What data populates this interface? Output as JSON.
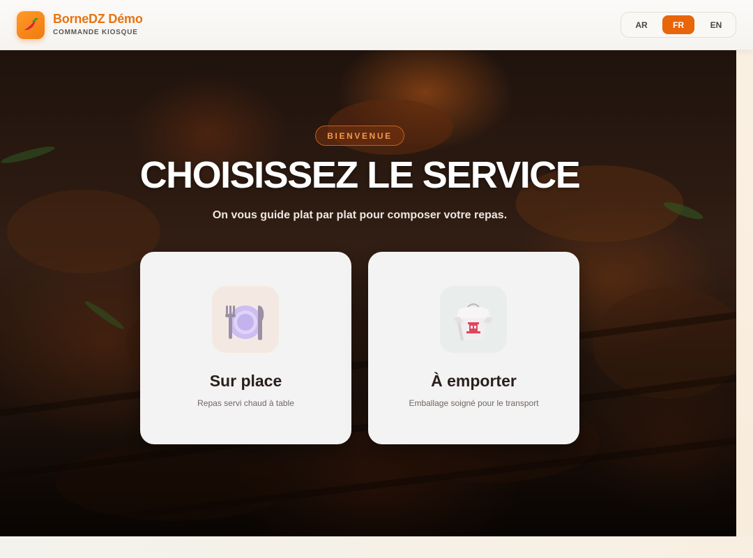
{
  "header": {
    "brand_name": "BorneDZ Démo",
    "brand_sub": "COMMANDE KIOSQUE",
    "logo_icon": "chili-pepper-icon",
    "languages": [
      {
        "label": "AR",
        "active": false
      },
      {
        "label": "FR",
        "active": true
      },
      {
        "label": "EN",
        "active": false
      }
    ]
  },
  "hero": {
    "badge": "BIENVENUE",
    "title": "CHOISISSEZ LE SERVICE",
    "subtitle": "On vous guide plat par plat pour composer votre repas."
  },
  "options": [
    {
      "title": "Sur place",
      "subtitle": "Repas servi chaud à table",
      "icon": "plate-cutlery-icon"
    },
    {
      "title": "À emporter",
      "subtitle": "Emballage soigné pour le transport",
      "icon": "takeout-box-icon"
    }
  ],
  "colors": {
    "accent": "#e8650a",
    "brand": "#e8730f",
    "badge_text": "#f39a4c"
  }
}
